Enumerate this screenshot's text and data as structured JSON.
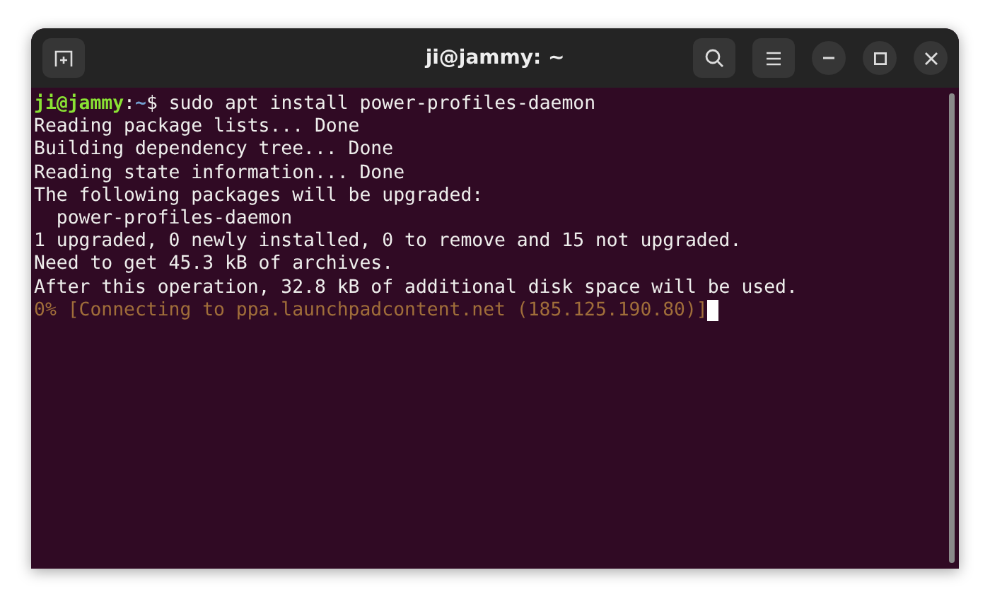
{
  "window": {
    "title": "ji@jammy: ~"
  },
  "terminal": {
    "lines": [
      {
        "kind": "prompt",
        "user_host": "ji@jammy",
        "separator": ":",
        "path": "~",
        "command": "$ sudo apt install power-profiles-daemon"
      },
      {
        "kind": "output",
        "text": "Reading package lists... Done"
      },
      {
        "kind": "output",
        "text": "Building dependency tree... Done"
      },
      {
        "kind": "output",
        "text": "Reading state information... Done"
      },
      {
        "kind": "output",
        "text": "The following packages will be upgraded:"
      },
      {
        "kind": "output",
        "text": "  power-profiles-daemon"
      },
      {
        "kind": "output",
        "text": "1 upgraded, 0 newly installed, 0 to remove and 15 not upgraded."
      },
      {
        "kind": "output",
        "text": "Need to get 45.3 kB of archives."
      },
      {
        "kind": "output",
        "text": "After this operation, 32.8 kB of additional disk space will be used."
      },
      {
        "kind": "progress",
        "text": "0% [Connecting to ppa.launchpadcontent.net (185.125.190.80)]",
        "cursor": true
      }
    ]
  }
}
